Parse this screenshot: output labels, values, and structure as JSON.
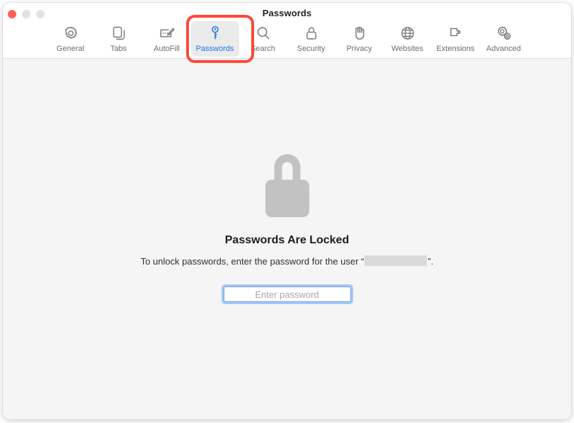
{
  "window": {
    "title": "Passwords",
    "controls": [
      {
        "name": "close",
        "color": "#ff5f57"
      },
      {
        "name": "minimize",
        "color": "#e2e2e2"
      },
      {
        "name": "zoom",
        "color": "#e2e2e2"
      }
    ]
  },
  "toolbar": {
    "tabs": [
      {
        "label": "General",
        "icon": "gear-icon",
        "selected": false
      },
      {
        "label": "Tabs",
        "icon": "tabs-icon",
        "selected": false
      },
      {
        "label": "AutoFill",
        "icon": "autofill-icon",
        "selected": false
      },
      {
        "label": "Passwords",
        "icon": "key-icon",
        "selected": true
      },
      {
        "label": "Search",
        "icon": "search-icon",
        "selected": false
      },
      {
        "label": "Security",
        "icon": "lock-icon",
        "selected": false
      },
      {
        "label": "Privacy",
        "icon": "hand-icon",
        "selected": false
      },
      {
        "label": "Websites",
        "icon": "globe-icon",
        "selected": false
      },
      {
        "label": "Extensions",
        "icon": "puzzle-icon",
        "selected": false
      },
      {
        "label": "Advanced",
        "icon": "gears-icon",
        "selected": false
      }
    ],
    "highlight": {
      "target": "Passwords",
      "color": "#ff483a"
    },
    "accent_color": "#1a73e8"
  },
  "main": {
    "lock_icon": "padlock-icon",
    "heading": "Passwords Are Locked",
    "message_prefix": "To unlock passwords, enter the password for the user “",
    "message_suffix": "”.",
    "redacted_user": "",
    "password_placeholder": "Enter password",
    "password_value": ""
  }
}
